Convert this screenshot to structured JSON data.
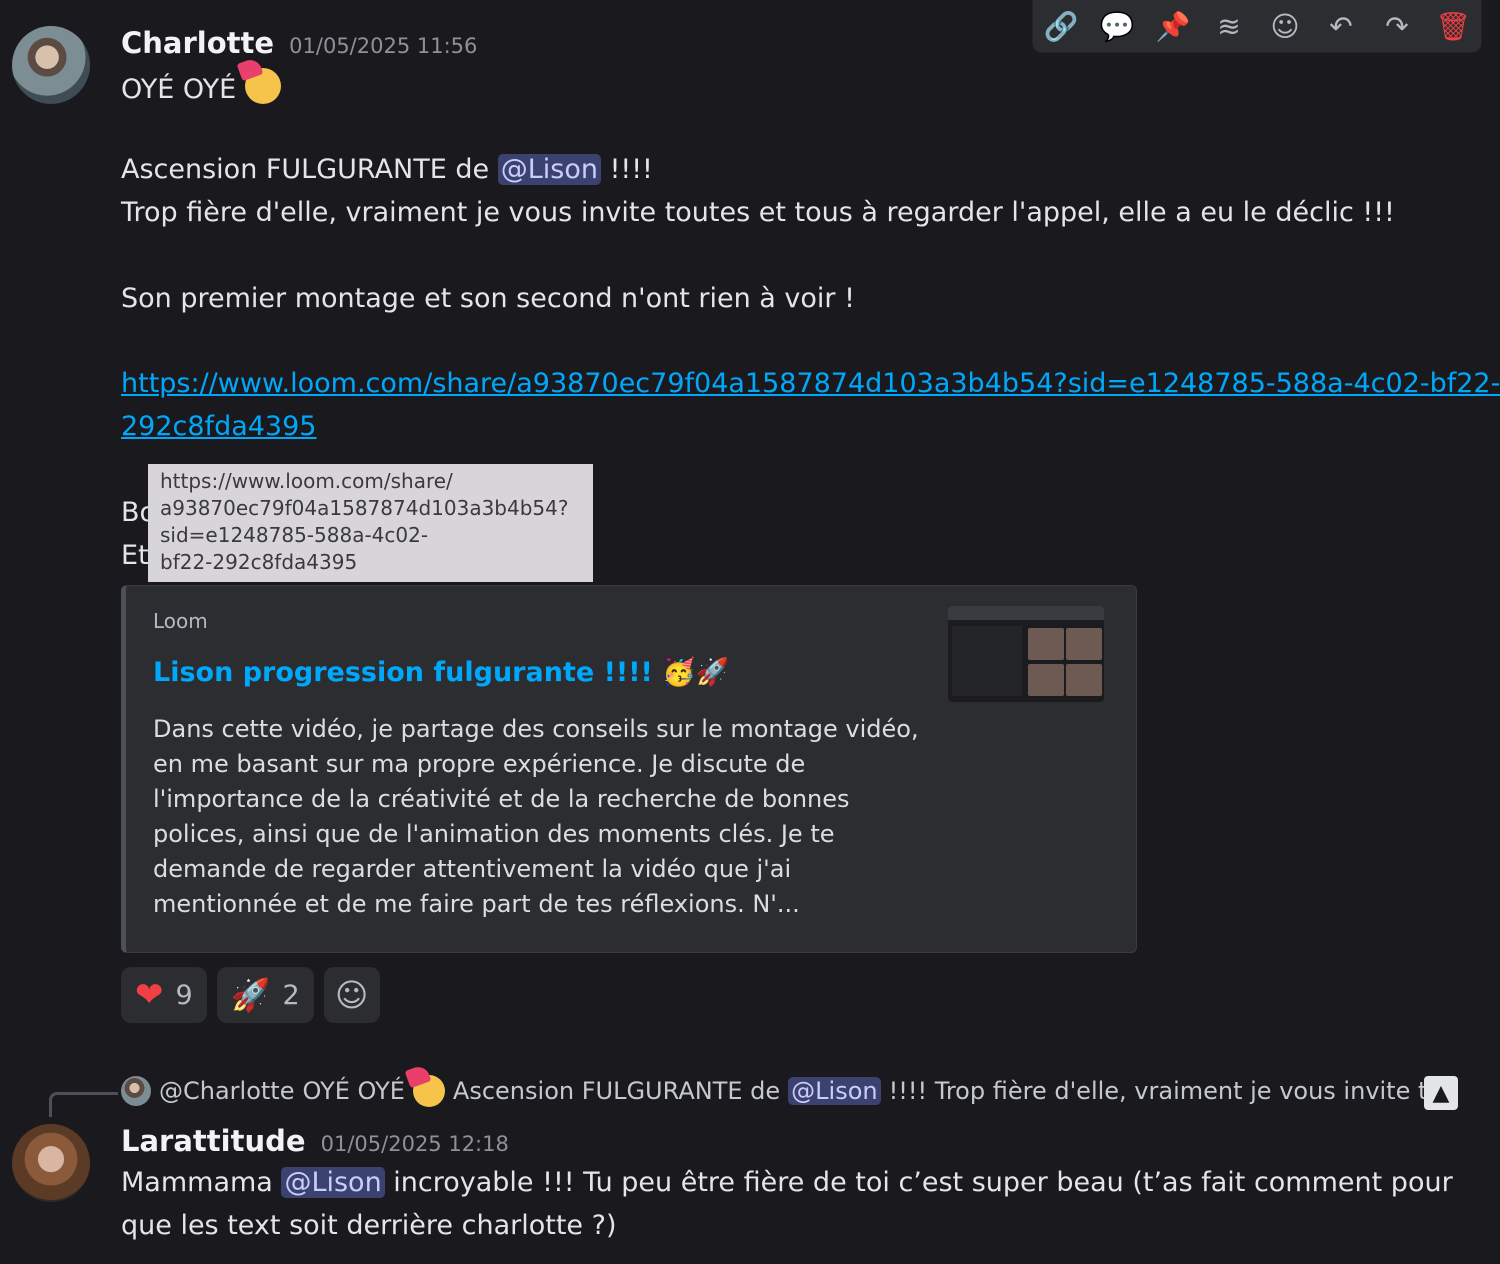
{
  "toolbar": {
    "icons": [
      "link-icon",
      "thread-icon",
      "pin-icon",
      "apps-icon",
      "add-reaction-icon",
      "reply-icon",
      "forward-icon",
      "trash-icon"
    ]
  },
  "message1": {
    "username": "Charlotte",
    "timestamp": "01/05/2025 11:56",
    "line1": "OYÉ OYÉ",
    "line2_pre": "Ascension FULGURANTE de",
    "mention": "@Lison",
    "line2_post": "!!!!",
    "line3": "Trop fière d'elle, vraiment je vous invite toutes et tous à regarder l'appel, elle a eu le déclic !!!",
    "line4": "Son premier montage et son second n'ont rien à voir !",
    "link_part1": "https://www.loom.com/share/a93870ec79f04a1587874d103a3b4b54?sid=e1248785-588a-4c02-bf22-",
    "link_part2": "292c8fda4395",
    "hidden_line1": "Bo",
    "hidden_line2": "Et"
  },
  "tooltip": {
    "line1": "https://www.loom.com/share/",
    "line2": "a93870ec79f04a1587874d103a3b4b54?",
    "line3": "sid=e1248785-588a-4c02-",
    "line4": "bf22-292c8fda4395"
  },
  "embed": {
    "provider": "Loom",
    "title": "Lison progression fulgurante !!!! 🥳🚀",
    "description": "Dans cette vidéo, je partage des conseils sur le montage vidéo, en me basant sur ma propre expérience. Je discute de l'importance de la créativité et de la recherche de bonnes polices, ainsi que de l'animation des moments clés. Je te demande de regarder attentivement la vidéo que j'ai mentionnée et de me faire part de tes réflexions. N'..."
  },
  "reactions": [
    {
      "emoji": "❤",
      "name": "heart",
      "count": "9"
    },
    {
      "emoji": "🚀",
      "name": "rocket",
      "count": "2"
    }
  ],
  "reply_preview": {
    "mention_author": "@Charlotte",
    "text_pre": "OYÉ OYÉ",
    "text_mid": "Ascension FULGURANTE de",
    "mention": "@Lison",
    "text_post": "!!!! Trop fière d'elle, vraiment je vous invite t..."
  },
  "message2": {
    "username": "Larattitude",
    "timestamp": "01/05/2025 12:18",
    "line1_pre": "Mammama",
    "mention": "@Lison",
    "line1_post": "incroyable !!! Tu peu être fière de toi c’est super beau (t’as fait comment pour",
    "line2": "que les text soit derrière charlotte ?)"
  }
}
